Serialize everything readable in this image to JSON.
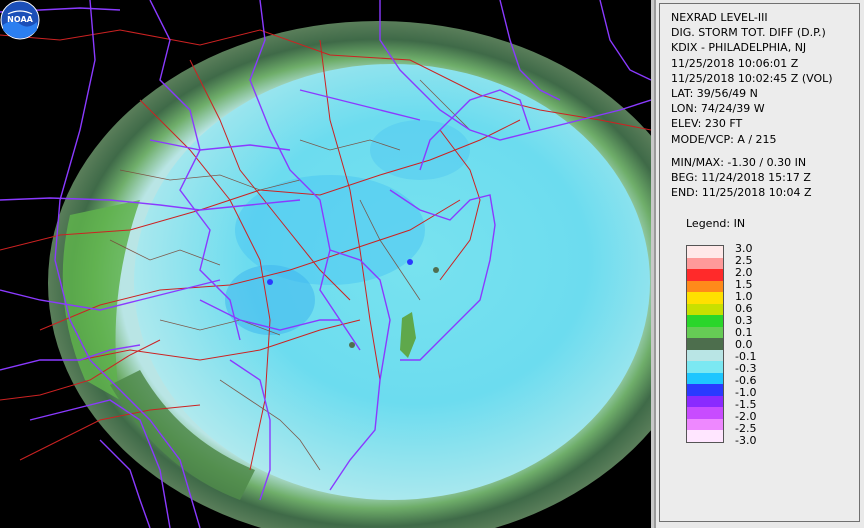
{
  "info": {
    "line1": "NEXRAD LEVEL-III",
    "line2": "DIG. STORM TOT. DIFF (D.P.)",
    "line3": "KDIX - PHILADELPHIA, NJ",
    "line4": "11/25/2018 10:06:01 Z",
    "line5": "11/25/2018 10:02:45 Z (VOL)",
    "lat": "LAT: 39/56/49 N",
    "lon": "LON: 74/24/39 W",
    "elev": "ELEV: 230 FT",
    "mode": "MODE/VCP: A / 215",
    "minmax": "MIN/MAX: -1.30 / 0.30 IN",
    "beg": "BEG: 11/24/2018 15:17 Z",
    "end": "END: 11/25/2018 10:04 Z"
  },
  "legend": {
    "title": "Legend: IN",
    "entries": [
      {
        "label": "3.0",
        "color": "#ffe9e9"
      },
      {
        "label": "2.5",
        "color": "#ff9a9a"
      },
      {
        "label": "2.0",
        "color": "#ff2a2a"
      },
      {
        "label": "1.5",
        "color": "#ff8a1a"
      },
      {
        "label": "1.0",
        "color": "#ffe000"
      },
      {
        "label": "0.6",
        "color": "#c8e000"
      },
      {
        "label": "0.3",
        "color": "#2ad62a"
      },
      {
        "label": "0.1",
        "color": "#66cc55"
      },
      {
        "label": "0.0",
        "color": "#4d6e4d"
      },
      {
        "label": "-0.1",
        "color": "#b9e5e5"
      },
      {
        "label": "-0.3",
        "color": "#7be8f2"
      },
      {
        "label": "-0.6",
        "color": "#1ec6ff"
      },
      {
        "label": "-1.0",
        "color": "#2a3aff"
      },
      {
        "label": "-1.5",
        "color": "#8a2aff"
      },
      {
        "label": "-2.0",
        "color": "#c84cff"
      },
      {
        "label": "-2.5",
        "color": "#ee88ff"
      },
      {
        "label": "-3.0",
        "color": "#ffe6ff"
      }
    ]
  },
  "logo": {
    "label": "NOAA"
  }
}
